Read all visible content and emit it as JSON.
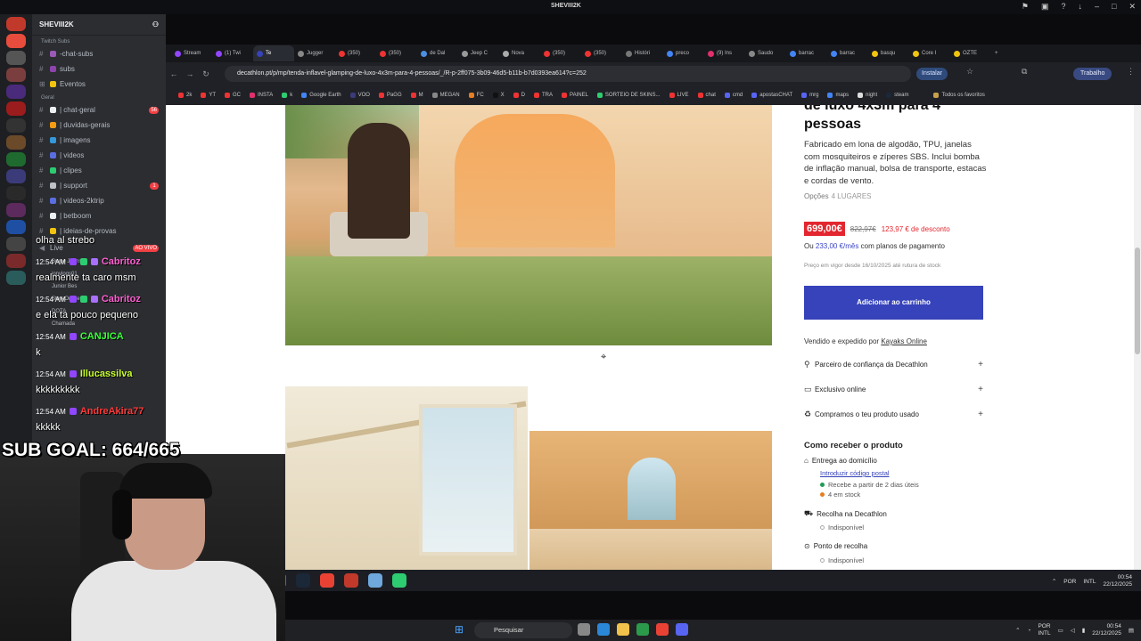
{
  "window": {
    "title": "SHEVIII2K"
  },
  "discord": {
    "server_name": "SHEVIII2K",
    "categories": [
      {
        "label": "Twitch Subs"
      },
      {
        "label": "Geral"
      }
    ],
    "channels_top": [
      {
        "label": "-chat-subs",
        "color": "#9b59b6"
      },
      {
        "label": "subs",
        "color": "#8e44ad"
      },
      {
        "label": "Eventos",
        "color": "#f1c40f"
      }
    ],
    "channels_main": [
      {
        "label": "| chat-geral",
        "badge": "56"
      },
      {
        "label": "| duvidas-gerais",
        "badge": ""
      },
      {
        "label": "| imagens",
        "badge": ""
      },
      {
        "label": "| videos",
        "badge": ""
      },
      {
        "label": "| clipes",
        "badge": ""
      },
      {
        "label": "| support",
        "badge": "1"
      },
      {
        "label": "| videos-2ktrip",
        "badge": ""
      },
      {
        "label": "| betboom",
        "badge": ""
      },
      {
        "label": "| ideias-de-provas",
        "badge": ""
      }
    ],
    "voice": [
      {
        "label": "Live",
        "badge": "AO VIVO"
      },
      {
        "label": "Bruce Johnson"
      },
      {
        "label": "jonvlogs01"
      },
      {
        "label": "Junior Bes"
      },
      {
        "label": "StereOnline"
      },
      {
        "label": "DOTA"
      },
      {
        "label": "Chamada"
      }
    ]
  },
  "browser": {
    "tabs": [
      "Stream",
      "(1) Twi",
      "Te",
      "Jugger",
      "(350)",
      "(350)",
      "de Dal",
      "Jeep C",
      "Nova",
      "(350)",
      "(350)",
      "Históri",
      "preco",
      "(9) Ins",
      "Saudo",
      "barrac",
      "barrac",
      "basqu",
      "Core I",
      "OZTE"
    ],
    "url": "decathlon.pt/p/mp/tenda-inflavel-glamping-de-luxo-4x3m-para-4-pessoas/_/R-p-2ff075-3b09-46d5-b11b-b7d0393ea614?c=252",
    "install_label": "Instalar",
    "profile_label": "Trabalho",
    "bookmarks": [
      "2k",
      "YT",
      "GC",
      "INSTA",
      "k",
      "Google Earth",
      "VOO",
      "PaGG",
      "M",
      "MEGAN",
      "FC",
      "X",
      "D",
      "TRA",
      "PAINEL",
      "SORTEIO DE SKINS...",
      "LIVE",
      "chat",
      "cmd",
      "apostasCHAT",
      "mrg",
      "maps",
      "night",
      "steam"
    ],
    "all_bookmarks": "Todos os favoritos"
  },
  "product": {
    "title_partial": "de luxo 4x3m para 4",
    "title_line2": "pessoas",
    "description": "Fabricado em lona de algodão, TPU, janelas com mosquiteiros e zíperes SBS. Inclui bomba de inflação manual, bolsa de transporte, estacas e cordas de vento.",
    "options_label": "Opções",
    "options_value": "4 LUGARES",
    "price": "699,00€",
    "old_price": "822,97€",
    "discount": "123,97 € de desconto",
    "installments_prefix": "Ou",
    "installments_amount": "233,00 €/mês",
    "installments_suffix": "com planos de pagamento",
    "price_note": "Preço em vigor desde 16/10/2025 até rutura de stock",
    "cart_button": "Adicionar ao carrinho",
    "sold_by_prefix": "Vendido e expedido por",
    "seller": "Kayaks Online",
    "accordions": [
      {
        "label": "Parceiro de confiança da Decathlon",
        "icon": "person-icon"
      },
      {
        "label": "Exclusivo online",
        "icon": "monitor-icon"
      },
      {
        "label": "Compramos o teu produto usado",
        "icon": "recycle-icon"
      }
    ],
    "delivery_heading": "Como receber o produto",
    "home_delivery": "Entrega ao domicílio",
    "postal_code_link": "Introduzir código postal",
    "receive_from": "Recebe a partir de 2 dias úteis",
    "in_stock": "4 em stock",
    "pickup_decathlon": "Recolha na Decathlon",
    "unavailable_1": "Indisponível",
    "pickup_point": "Ponto de recolha",
    "unavailable_2": "Indisponível"
  },
  "stream": {
    "messages": [
      {
        "time": "",
        "user": "",
        "text": "olha al strebo",
        "color": "#ffffff"
      },
      {
        "time": "12:54 AM",
        "user": "Cabritoz",
        "text": "realmente ta caro msm",
        "color": "#ff5fd2"
      },
      {
        "time": "12:54 AM",
        "user": "Cabritoz",
        "text": "e ela ta pouco pequeno",
        "color": "#ff5fd2"
      },
      {
        "time": "12:54 AM",
        "user": "CANJICA",
        "text": "k",
        "color": "#3aff3a"
      },
      {
        "time": "12:54 AM",
        "user": "Illucassilva",
        "text": "kkkkkkkkk",
        "color": "#c8ff2e"
      },
      {
        "time": "12:54 AM",
        "user": "AndreAkira77",
        "text": "kkkkk",
        "color": "#ff3b3b"
      }
    ],
    "sub_goal": "SUB GOAL: 664/665"
  },
  "taskbar": {
    "search_placeholder": "Pesquisar",
    "lang": "POR",
    "layout": "INTL",
    "time": "00:54",
    "date": "22/12/2025"
  },
  "inner_taskbar": {
    "lang": "POR",
    "layout": "INTL",
    "time": "00:54",
    "date": "22/12/2025"
  }
}
